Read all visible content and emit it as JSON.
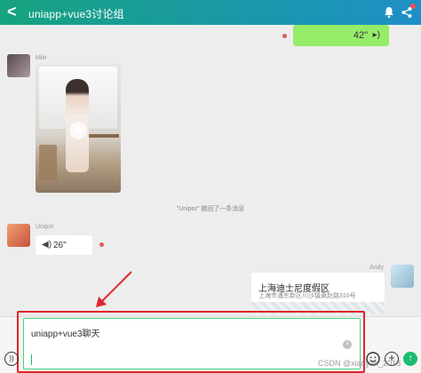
{
  "header": {
    "title": "uniapp+vue3讨论组",
    "back_glyph": "<"
  },
  "messages": {
    "self_voice": {
      "duration": "42\""
    },
    "miki": {
      "name": "Miki"
    },
    "system_notice": "\"Unipor\" 撤回了一条消息",
    "unipor": {
      "name": "Unipor",
      "voice_duration": "26\""
    },
    "andy": {
      "name": "Andy",
      "location": {
        "title": "上海迪士尼度假区",
        "address": "上海市浦东新区川沙镇黄赵路310号"
      }
    }
  },
  "composer": {
    "text": "uniapp+vue3聊天",
    "clear_glyph": "×",
    "plus_glyph": "+",
    "send_glyph": "↑",
    "voice_glyph": "))"
  },
  "watermark": "CSDN @xiaoyan_2018",
  "colors": {
    "header_start": "#16a37f",
    "header_end": "#1e8fc7",
    "self_bubble": "#95ec69",
    "highlight_box": "#e0252b",
    "input_border": "#46d07c",
    "send_button": "#1cbc72"
  }
}
